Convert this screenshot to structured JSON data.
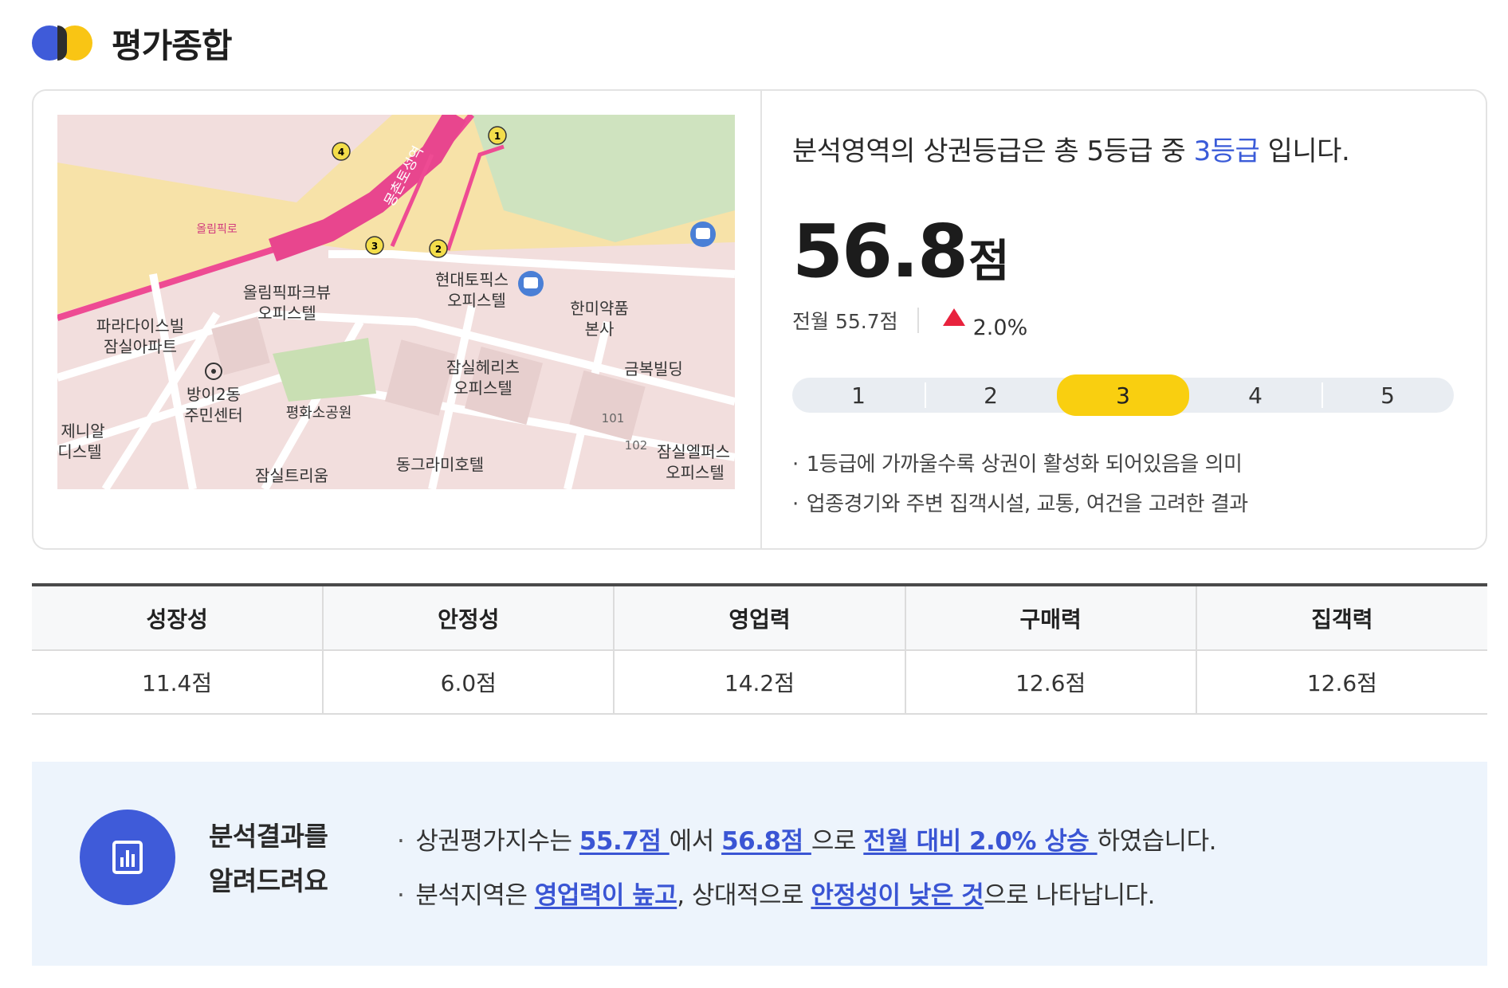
{
  "header": {
    "title": "평가종합"
  },
  "summary": {
    "map": {
      "labels": [
        "올림픽로",
        "올림픽파크뷰",
        "오피스텔",
        "파라다이스빌",
        "잠실아파트",
        "방이2동",
        "주민센터",
        "평화소공원",
        "제니알",
        "디스텔",
        "잠실트리움",
        "현대토픽스",
        "오피스텔",
        "한미약품",
        "본사",
        "잠실헤리츠",
        "오피스텔",
        "금복빌딩",
        "동그라미호텔",
        "잠실엘퍼스",
        "오피스텔",
        "몽촌토성역",
        "101",
        "102",
        "1",
        "2",
        "3",
        "4"
      ]
    },
    "grade_sentence": {
      "prefix": "분석영역의 상권등급은 총 5등급 중 ",
      "grade": "3등급",
      "suffix": " 입니다."
    },
    "score_value": "56.8",
    "score_unit": "점",
    "prev_label": "전월 55.7점",
    "change": "2.0%",
    "change_direction": "up",
    "grades": [
      "1",
      "2",
      "3",
      "4",
      "5"
    ],
    "active_grade": "3",
    "notes": [
      "1등급에 가까울수록 상권이 활성화 되어있음을 의미",
      "업종경기와 주변 집객시설, 교통, 여건을 고려한 결과"
    ]
  },
  "table": {
    "headers": [
      "성장성",
      "안정성",
      "영업력",
      "구매력",
      "집객력"
    ],
    "values": [
      "11.4점",
      "6.0점",
      "14.2점",
      "12.6점",
      "12.6점"
    ]
  },
  "result": {
    "title_line1": "분석결과를",
    "title_line2": "알려드려요",
    "bullet": "·",
    "line1": {
      "t1": "상권평가지수는 ",
      "l1": "55.7점 ",
      "t2": "에서 ",
      "l2": "56.8점 ",
      "t3": "으로 ",
      "l3": "전월 대비 2.0% 상승 ",
      "t4": "하였습니다."
    },
    "line2": {
      "t1": "분석지역은 ",
      "l1": "영업력이 높고",
      "t2": ", 상대적으로 ",
      "l2": "안정성이 낮은 것",
      "t3": "으로 나타납니다."
    }
  },
  "colors": {
    "accent_blue": "#3f5bd9",
    "accent_yellow": "#f9c514",
    "up_red": "#e8223d",
    "link_blue": "#3a55d4"
  },
  "icons": {
    "result_icon": "bar-chart-document-icon",
    "bus": "bus-stop-icon",
    "subway": "subway-icon"
  }
}
